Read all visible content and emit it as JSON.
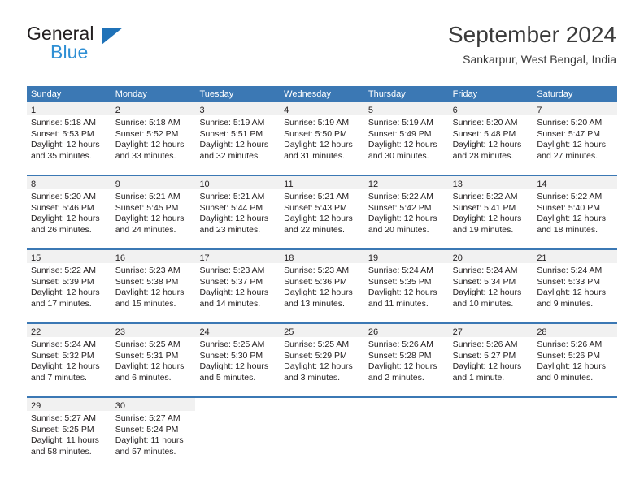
{
  "brand": {
    "name_top": "General",
    "name_bottom": "Blue",
    "triangle_color": "#1f72b8",
    "blue_text_color": "#2f8fd4"
  },
  "header": {
    "title": "September 2024",
    "location": "Sankarpur, West Bengal, India"
  },
  "colors": {
    "header_blue": "#3b78b4",
    "daynum_bg": "#f1f1f1",
    "text": "#231f20"
  },
  "weekdays": [
    "Sunday",
    "Monday",
    "Tuesday",
    "Wednesday",
    "Thursday",
    "Friday",
    "Saturday"
  ],
  "weeks": [
    [
      {
        "day": "1",
        "sunrise": "Sunrise: 5:18 AM",
        "sunset": "Sunset: 5:53 PM",
        "daylight1": "Daylight: 12 hours",
        "daylight2": "and 35 minutes."
      },
      {
        "day": "2",
        "sunrise": "Sunrise: 5:18 AM",
        "sunset": "Sunset: 5:52 PM",
        "daylight1": "Daylight: 12 hours",
        "daylight2": "and 33 minutes."
      },
      {
        "day": "3",
        "sunrise": "Sunrise: 5:19 AM",
        "sunset": "Sunset: 5:51 PM",
        "daylight1": "Daylight: 12 hours",
        "daylight2": "and 32 minutes."
      },
      {
        "day": "4",
        "sunrise": "Sunrise: 5:19 AM",
        "sunset": "Sunset: 5:50 PM",
        "daylight1": "Daylight: 12 hours",
        "daylight2": "and 31 minutes."
      },
      {
        "day": "5",
        "sunrise": "Sunrise: 5:19 AM",
        "sunset": "Sunset: 5:49 PM",
        "daylight1": "Daylight: 12 hours",
        "daylight2": "and 30 minutes."
      },
      {
        "day": "6",
        "sunrise": "Sunrise: 5:20 AM",
        "sunset": "Sunset: 5:48 PM",
        "daylight1": "Daylight: 12 hours",
        "daylight2": "and 28 minutes."
      },
      {
        "day": "7",
        "sunrise": "Sunrise: 5:20 AM",
        "sunset": "Sunset: 5:47 PM",
        "daylight1": "Daylight: 12 hours",
        "daylight2": "and 27 minutes."
      }
    ],
    [
      {
        "day": "8",
        "sunrise": "Sunrise: 5:20 AM",
        "sunset": "Sunset: 5:46 PM",
        "daylight1": "Daylight: 12 hours",
        "daylight2": "and 26 minutes."
      },
      {
        "day": "9",
        "sunrise": "Sunrise: 5:21 AM",
        "sunset": "Sunset: 5:45 PM",
        "daylight1": "Daylight: 12 hours",
        "daylight2": "and 24 minutes."
      },
      {
        "day": "10",
        "sunrise": "Sunrise: 5:21 AM",
        "sunset": "Sunset: 5:44 PM",
        "daylight1": "Daylight: 12 hours",
        "daylight2": "and 23 minutes."
      },
      {
        "day": "11",
        "sunrise": "Sunrise: 5:21 AM",
        "sunset": "Sunset: 5:43 PM",
        "daylight1": "Daylight: 12 hours",
        "daylight2": "and 22 minutes."
      },
      {
        "day": "12",
        "sunrise": "Sunrise: 5:22 AM",
        "sunset": "Sunset: 5:42 PM",
        "daylight1": "Daylight: 12 hours",
        "daylight2": "and 20 minutes."
      },
      {
        "day": "13",
        "sunrise": "Sunrise: 5:22 AM",
        "sunset": "Sunset: 5:41 PM",
        "daylight1": "Daylight: 12 hours",
        "daylight2": "and 19 minutes."
      },
      {
        "day": "14",
        "sunrise": "Sunrise: 5:22 AM",
        "sunset": "Sunset: 5:40 PM",
        "daylight1": "Daylight: 12 hours",
        "daylight2": "and 18 minutes."
      }
    ],
    [
      {
        "day": "15",
        "sunrise": "Sunrise: 5:22 AM",
        "sunset": "Sunset: 5:39 PM",
        "daylight1": "Daylight: 12 hours",
        "daylight2": "and 17 minutes."
      },
      {
        "day": "16",
        "sunrise": "Sunrise: 5:23 AM",
        "sunset": "Sunset: 5:38 PM",
        "daylight1": "Daylight: 12 hours",
        "daylight2": "and 15 minutes."
      },
      {
        "day": "17",
        "sunrise": "Sunrise: 5:23 AM",
        "sunset": "Sunset: 5:37 PM",
        "daylight1": "Daylight: 12 hours",
        "daylight2": "and 14 minutes."
      },
      {
        "day": "18",
        "sunrise": "Sunrise: 5:23 AM",
        "sunset": "Sunset: 5:36 PM",
        "daylight1": "Daylight: 12 hours",
        "daylight2": "and 13 minutes."
      },
      {
        "day": "19",
        "sunrise": "Sunrise: 5:24 AM",
        "sunset": "Sunset: 5:35 PM",
        "daylight1": "Daylight: 12 hours",
        "daylight2": "and 11 minutes."
      },
      {
        "day": "20",
        "sunrise": "Sunrise: 5:24 AM",
        "sunset": "Sunset: 5:34 PM",
        "daylight1": "Daylight: 12 hours",
        "daylight2": "and 10 minutes."
      },
      {
        "day": "21",
        "sunrise": "Sunrise: 5:24 AM",
        "sunset": "Sunset: 5:33 PM",
        "daylight1": "Daylight: 12 hours",
        "daylight2": "and 9 minutes."
      }
    ],
    [
      {
        "day": "22",
        "sunrise": "Sunrise: 5:24 AM",
        "sunset": "Sunset: 5:32 PM",
        "daylight1": "Daylight: 12 hours",
        "daylight2": "and 7 minutes."
      },
      {
        "day": "23",
        "sunrise": "Sunrise: 5:25 AM",
        "sunset": "Sunset: 5:31 PM",
        "daylight1": "Daylight: 12 hours",
        "daylight2": "and 6 minutes."
      },
      {
        "day": "24",
        "sunrise": "Sunrise: 5:25 AM",
        "sunset": "Sunset: 5:30 PM",
        "daylight1": "Daylight: 12 hours",
        "daylight2": "and 5 minutes."
      },
      {
        "day": "25",
        "sunrise": "Sunrise: 5:25 AM",
        "sunset": "Sunset: 5:29 PM",
        "daylight1": "Daylight: 12 hours",
        "daylight2": "and 3 minutes."
      },
      {
        "day": "26",
        "sunrise": "Sunrise: 5:26 AM",
        "sunset": "Sunset: 5:28 PM",
        "daylight1": "Daylight: 12 hours",
        "daylight2": "and 2 minutes."
      },
      {
        "day": "27",
        "sunrise": "Sunrise: 5:26 AM",
        "sunset": "Sunset: 5:27 PM",
        "daylight1": "Daylight: 12 hours",
        "daylight2": "and 1 minute."
      },
      {
        "day": "28",
        "sunrise": "Sunrise: 5:26 AM",
        "sunset": "Sunset: 5:26 PM",
        "daylight1": "Daylight: 12 hours",
        "daylight2": "and 0 minutes."
      }
    ],
    [
      {
        "day": "29",
        "sunrise": "Sunrise: 5:27 AM",
        "sunset": "Sunset: 5:25 PM",
        "daylight1": "Daylight: 11 hours",
        "daylight2": "and 58 minutes."
      },
      {
        "day": "30",
        "sunrise": "Sunrise: 5:27 AM",
        "sunset": "Sunset: 5:24 PM",
        "daylight1": "Daylight: 11 hours",
        "daylight2": "and 57 minutes."
      },
      {
        "day": "",
        "sunrise": "",
        "sunset": "",
        "daylight1": "",
        "daylight2": ""
      },
      {
        "day": "",
        "sunrise": "",
        "sunset": "",
        "daylight1": "",
        "daylight2": ""
      },
      {
        "day": "",
        "sunrise": "",
        "sunset": "",
        "daylight1": "",
        "daylight2": ""
      },
      {
        "day": "",
        "sunrise": "",
        "sunset": "",
        "daylight1": "",
        "daylight2": ""
      },
      {
        "day": "",
        "sunrise": "",
        "sunset": "",
        "daylight1": "",
        "daylight2": ""
      }
    ]
  ]
}
